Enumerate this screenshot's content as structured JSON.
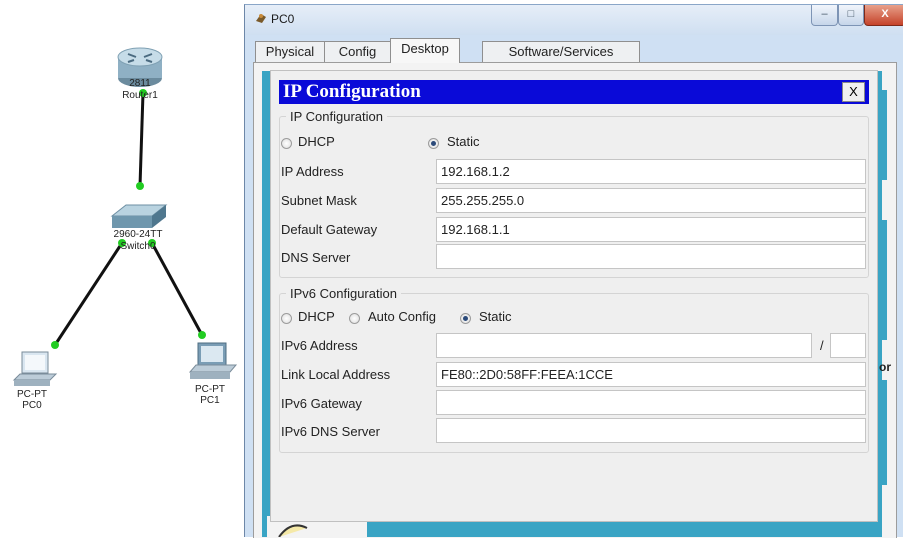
{
  "topology": {
    "router": {
      "model": "2811",
      "name": "Router1"
    },
    "switch": {
      "model": "2960-24TT",
      "name": "Switch0"
    },
    "pc0": {
      "type": "PC-PT",
      "name": "PC0"
    },
    "pc1": {
      "type": "PC-PT",
      "name": "PC1"
    }
  },
  "window": {
    "title": "PC0",
    "buttons": {
      "minimize": "–",
      "maximize": "□",
      "close": "X"
    }
  },
  "tabs": [
    {
      "label": "Physical",
      "active": false
    },
    {
      "label": "Config",
      "active": false
    },
    {
      "label": "Desktop",
      "active": true
    },
    {
      "label": "Software/Services",
      "active": false
    }
  ],
  "ip_config": {
    "title": "IP Configuration",
    "close_label": "X",
    "ipv4_group_label": "IP Configuration",
    "mode_options": {
      "dhcp": "DHCP",
      "static": "Static"
    },
    "selected_mode": "Static",
    "fields": {
      "ip_address": {
        "label": "IP Address",
        "value": "192.168.1.2"
      },
      "subnet_mask": {
        "label": "Subnet Mask",
        "value": "255.255.255.0"
      },
      "default_gateway": {
        "label": "Default Gateway",
        "value": "192.168.1.1"
      },
      "dns_server": {
        "label": "DNS Server",
        "value": ""
      }
    },
    "ipv6_group_label": "IPv6 Configuration",
    "ipv6_mode_options": {
      "dhcp": "DHCP",
      "auto": "Auto Config",
      "static": "Static"
    },
    "ipv6_selected_mode": "Static",
    "ipv6_fields": {
      "address": {
        "label": "IPv6 Address",
        "value": "",
        "prefix_separator": "/",
        "prefix": ""
      },
      "link_local": {
        "label": "Link Local Address",
        "value": "FE80::2D0:58FF:FEEA:1CCE"
      },
      "gateway": {
        "label": "IPv6 Gateway",
        "value": ""
      },
      "dns": {
        "label": "IPv6 DNS Server",
        "value": ""
      }
    }
  },
  "background_fragments": {
    "right_edge_text": "or"
  },
  "colors": {
    "dialog_title_bg": "#0a0ad8",
    "desktop_bg": "#39a4c4",
    "link_green": "#22cc22",
    "radio_dot": "#2b4a7a"
  }
}
